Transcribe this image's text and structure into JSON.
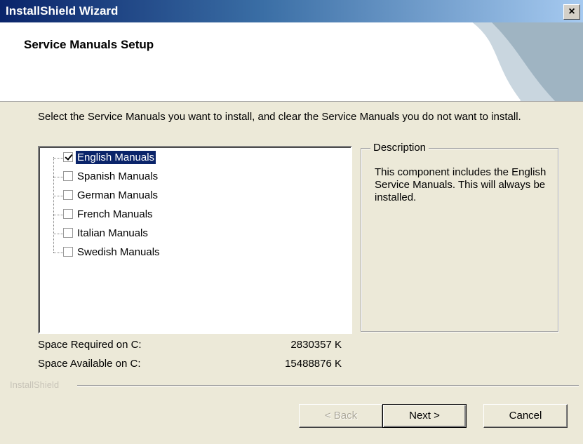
{
  "window": {
    "title": "InstallShield Wizard",
    "close_label": "×"
  },
  "header": {
    "title": "Service Manuals Setup"
  },
  "instructions": "Select the Service Manuals you want to install, and clear the Service Manuals you do not want to install.",
  "components": [
    {
      "label": "English Manuals",
      "checked": true,
      "selected": true
    },
    {
      "label": "Spanish Manuals",
      "checked": false,
      "selected": false
    },
    {
      "label": "German Manuals",
      "checked": false,
      "selected": false
    },
    {
      "label": "French Manuals",
      "checked": false,
      "selected": false
    },
    {
      "label": "Italian Manuals",
      "checked": false,
      "selected": false
    },
    {
      "label": "Swedish Manuals",
      "checked": false,
      "selected": false
    }
  ],
  "description": {
    "legend": "Description",
    "text": "This component includes the English Service Manuals.  This will always be installed."
  },
  "space": {
    "required_label": "Space Required on  C:",
    "required_value": "2830357 K",
    "available_label": "Space Available on  C:",
    "available_value": "15488876 K"
  },
  "brand": "InstallShield",
  "buttons": {
    "back": "< Back",
    "next": "Next >",
    "cancel": "Cancel"
  },
  "colors": {
    "titlebar": "#0a246a",
    "selection": "#0a246a",
    "face": "#ece9d8"
  }
}
